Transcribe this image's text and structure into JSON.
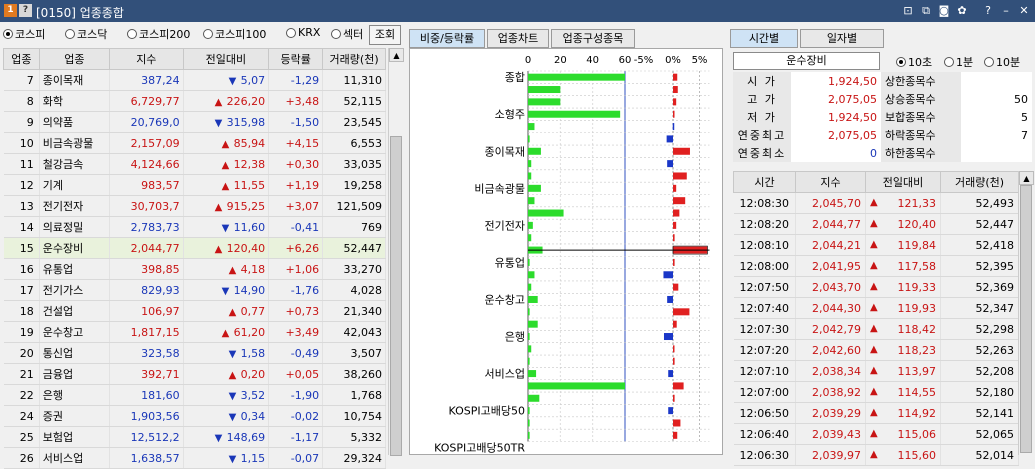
{
  "window": {
    "badge1": "1",
    "badge2": "?",
    "title": "[0150] 업종종합",
    "title_color": "#32507a"
  },
  "left": {
    "market_options": [
      {
        "label": "코스피",
        "selected": true
      },
      {
        "label": "코스닥",
        "selected": false
      },
      {
        "label": "코스피200",
        "selected": false
      },
      {
        "label": "코스피100",
        "selected": false
      },
      {
        "label": "KRX",
        "selected": false
      },
      {
        "label": "섹터",
        "selected": false
      }
    ],
    "query_button": "조회",
    "headers": [
      "업종",
      "업종",
      "지수",
      "전일대비",
      "등락률",
      "거래량(천)"
    ],
    "rows": [
      {
        "code": "7",
        "name": "종이목재",
        "index": "387,24",
        "dir": "dn",
        "change": "5,07",
        "rate": "-1,29",
        "volume": "11,310"
      },
      {
        "code": "8",
        "name": "화학",
        "index": "6,729,77",
        "dir": "up",
        "change": "226,20",
        "rate": "+3,48",
        "volume": "52,115"
      },
      {
        "code": "9",
        "name": "의약품",
        "index": "20,769,0",
        "dir": "dn",
        "change": "315,98",
        "rate": "-1,50",
        "volume": "23,545"
      },
      {
        "code": "10",
        "name": "비금속광물",
        "index": "2,157,09",
        "dir": "up",
        "change": "85,94",
        "rate": "+4,15",
        "volume": "6,553"
      },
      {
        "code": "11",
        "name": "철강금속",
        "index": "4,124,66",
        "dir": "up",
        "change": "12,38",
        "rate": "+0,30",
        "volume": "33,035"
      },
      {
        "code": "12",
        "name": "기계",
        "index": "983,57",
        "dir": "up",
        "change": "11,55",
        "rate": "+1,19",
        "volume": "19,258"
      },
      {
        "code": "13",
        "name": "전기전자",
        "index": "30,703,7",
        "dir": "up",
        "change": "915,25",
        "rate": "+3,07",
        "volume": "121,509"
      },
      {
        "code": "14",
        "name": "의료정밀",
        "index": "2,783,73",
        "dir": "dn",
        "change": "11,60",
        "rate": "-0,41",
        "volume": "769"
      },
      {
        "code": "15",
        "name": "운수장비",
        "index": "2,044,77",
        "dir": "up",
        "change": "120,40",
        "rate": "+6,26",
        "volume": "52,447"
      },
      {
        "code": "16",
        "name": "유통업",
        "index": "398,85",
        "dir": "up",
        "change": "4,18",
        "rate": "+1,06",
        "volume": "33,270"
      },
      {
        "code": "17",
        "name": "전기가스",
        "index": "829,93",
        "dir": "dn",
        "change": "14,90",
        "rate": "-1,76",
        "volume": "4,028"
      },
      {
        "code": "18",
        "name": "건설업",
        "index": "106,97",
        "dir": "up",
        "change": "0,77",
        "rate": "+0,73",
        "volume": "21,340"
      },
      {
        "code": "19",
        "name": "운수창고",
        "index": "1,817,15",
        "dir": "up",
        "change": "61,20",
        "rate": "+3,49",
        "volume": "42,043"
      },
      {
        "code": "20",
        "name": "통신업",
        "index": "323,58",
        "dir": "dn",
        "change": "1,58",
        "rate": "-0,49",
        "volume": "3,507"
      },
      {
        "code": "21",
        "name": "금융업",
        "index": "392,71",
        "dir": "up",
        "change": "0,20",
        "rate": "+0,05",
        "volume": "38,260"
      },
      {
        "code": "22",
        "name": "은행",
        "index": "181,60",
        "dir": "dn",
        "change": "3,52",
        "rate": "-1,90",
        "volume": "1,768"
      },
      {
        "code": "24",
        "name": "증권",
        "index": "1,903,56",
        "dir": "dn",
        "change": "0,34",
        "rate": "-0,02",
        "volume": "10,754"
      },
      {
        "code": "25",
        "name": "보험업",
        "index": "12,512,2",
        "dir": "dn",
        "change": "148,69",
        "rate": "-1,17",
        "volume": "5,332"
      },
      {
        "code": "26",
        "name": "서비스업",
        "index": "1,638,57",
        "dir": "dn",
        "change": "1,15",
        "rate": "-0,07",
        "volume": "29,324"
      }
    ],
    "selected_row_code": "15"
  },
  "middle": {
    "tabs": [
      "비중/등락률",
      "업종차트",
      "업종구성종목"
    ],
    "active_tab": 0,
    "weight_ticks": [
      "0",
      "20",
      "40",
      "60"
    ],
    "rate_ticks": [
      "-5%",
      "0%",
      "5%"
    ],
    "category_labels": [
      "종합",
      "소형주",
      "종이목재",
      "비금속광물",
      "전기전자",
      "유통업",
      "운수창고",
      "은행",
      "서비스업",
      "KOSPI고배당50",
      "KOSPI고배당50TR"
    ]
  },
  "chart_data": {
    "type": "bar",
    "panels": [
      {
        "name": "weight",
        "xlim": [
          0,
          60
        ],
        "ticks": [
          0,
          20,
          40,
          60
        ]
      },
      {
        "name": "change_rate",
        "xlim": [
          -5,
          5
        ],
        "ticks": [
          "-5%",
          "0%",
          "5%"
        ]
      }
    ],
    "rows": 30,
    "weight": [
      100,
      20,
      20,
      57,
      4,
      1,
      8,
      2,
      2,
      8,
      4,
      22,
      3,
      2,
      9,
      1,
      4,
      2,
      6,
      1,
      6,
      1,
      2,
      1,
      5,
      100,
      7,
      1,
      1,
      1
    ],
    "change_rate": [
      0.8,
      0.9,
      0.6,
      0.1,
      -0.05,
      -1.2,
      3.2,
      -1.1,
      2.6,
      0.6,
      2.3,
      1.2,
      0.6,
      0.3,
      6.5,
      0.3,
      -1.8,
      1.0,
      -1.1,
      3.1,
      0.7,
      -1.7,
      0.0,
      0.3,
      -0.9,
      2.0,
      0.3,
      -0.9,
      1.4,
      0.8
    ],
    "highlight_row": 14,
    "weight_color": "#2cdc2c",
    "up_color": "#e02020",
    "down_color": "#1a37c8"
  },
  "right": {
    "tabs": [
      "시간별",
      "일자별"
    ],
    "active_tab": 0,
    "sector_name": "운수장비",
    "interval_options": [
      {
        "label": "10초",
        "selected": true
      },
      {
        "label": "1분",
        "selected": false
      },
      {
        "label": "10분",
        "selected": false
      }
    ],
    "info": [
      {
        "k": "시 가",
        "v": "1,924,50",
        "k2": "상한종목수",
        "v2": ""
      },
      {
        "k": "고 가",
        "v": "2,075,05",
        "k2": "상승종목수",
        "v2": "50"
      },
      {
        "k": "저 가",
        "v": "1,924,50",
        "k2": "보합종목수",
        "v2": "5"
      },
      {
        "k": "연중최고",
        "v": "2,075,05",
        "k2": "하락종목수",
        "v2": "7"
      },
      {
        "k": "연중최소",
        "v": "0",
        "k2": "하한종목수",
        "v2": ""
      }
    ],
    "time_headers": [
      "시간",
      "지수",
      "전일대비",
      "거래량(천)"
    ],
    "time_rows": [
      {
        "time": "12:08:30",
        "index": "2,045,70",
        "change": "121,33",
        "volume": "52,493"
      },
      {
        "time": "12:08:20",
        "index": "2,044,77",
        "change": "120,40",
        "volume": "52,447"
      },
      {
        "time": "12:08:10",
        "index": "2,044,21",
        "change": "119,84",
        "volume": "52,418"
      },
      {
        "time": "12:08:00",
        "index": "2,041,95",
        "change": "117,58",
        "volume": "52,395"
      },
      {
        "time": "12:07:50",
        "index": "2,043,70",
        "change": "119,33",
        "volume": "52,369"
      },
      {
        "time": "12:07:40",
        "index": "2,044,30",
        "change": "119,93",
        "volume": "52,347"
      },
      {
        "time": "12:07:30",
        "index": "2,042,79",
        "change": "118,42",
        "volume": "52,298"
      },
      {
        "time": "12:07:20",
        "index": "2,042,60",
        "change": "118,23",
        "volume": "52,263"
      },
      {
        "time": "12:07:10",
        "index": "2,038,34",
        "change": "113,97",
        "volume": "52,208"
      },
      {
        "time": "12:07:00",
        "index": "2,038,92",
        "change": "114,55",
        "volume": "52,180"
      },
      {
        "time": "12:06:50",
        "index": "2,039,29",
        "change": "114,92",
        "volume": "52,141"
      },
      {
        "time": "12:06:40",
        "index": "2,039,43",
        "change": "115,06",
        "volume": "52,065"
      },
      {
        "time": "12:06:30",
        "index": "2,039,97",
        "change": "115,60",
        "volume": "52,014"
      }
    ]
  },
  "colors": {
    "up": "#c81414",
    "down": "#1a37b8",
    "selected_row_bg": "#e9f2dc",
    "active_tab_bg": "#cfe3f5"
  },
  "icons": {
    "up": "▲",
    "down": "▼",
    "toolbar": [
      "window-pin-icon",
      "copy-icon",
      "screenshot-icon",
      "settings-icon",
      "help-icon",
      "minimize-icon",
      "close-icon"
    ]
  }
}
